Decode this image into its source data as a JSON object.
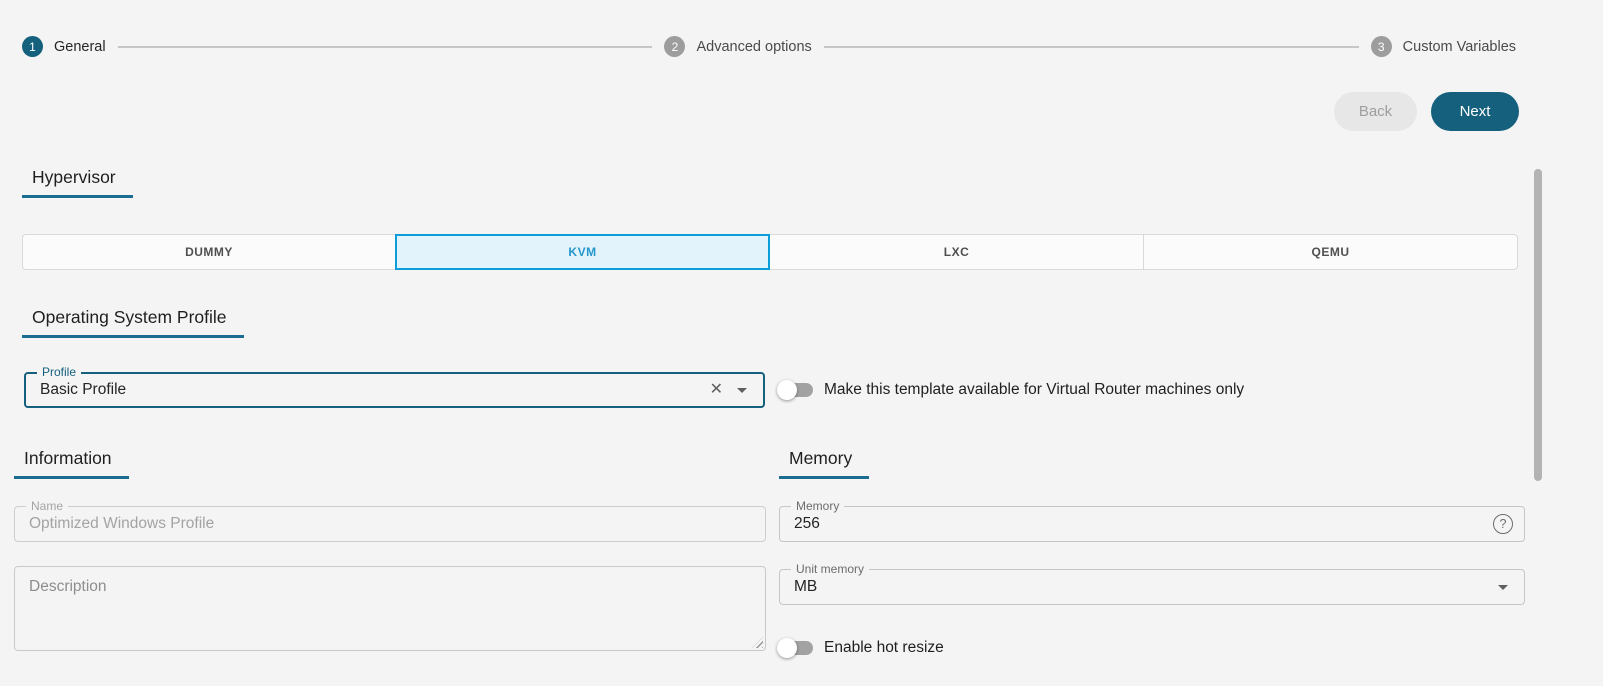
{
  "colors": {
    "page_bg": "#f4f4f4",
    "primary": "#15607d",
    "accent_underline": "#1a6c90",
    "step_inactive": "#9d9d9d",
    "kvm_border": "#0c9ed9",
    "kvm_bg": "#e3f3fb",
    "kvm_text": "#2497cb"
  },
  "stepper": {
    "steps": [
      {
        "number": "1",
        "label": "General",
        "active": true
      },
      {
        "number": "2",
        "label": "Advanced options",
        "active": false
      },
      {
        "number": "3",
        "label": "Custom Variables",
        "active": false
      }
    ]
  },
  "actions": {
    "back": "Back",
    "next": "Next"
  },
  "hypervisor": {
    "heading": "Hypervisor",
    "options": [
      {
        "label": "DUMMY",
        "selected": false
      },
      {
        "label": "KVM",
        "selected": true
      },
      {
        "label": "LXC",
        "selected": false
      },
      {
        "label": "QEMU",
        "selected": false
      }
    ]
  },
  "os_profile": {
    "heading": "Operating System Profile",
    "profile_field": {
      "label": "Profile",
      "value": "Basic Profile"
    },
    "vrouter_toggle": {
      "label": "Make this template available for Virtual Router machines only",
      "enabled": false
    }
  },
  "information": {
    "heading": "Information",
    "name_field": {
      "label": "Name",
      "value": "Optimized Windows Profile",
      "disabled": true
    },
    "description_field": {
      "placeholder": "Description",
      "value": ""
    }
  },
  "memory": {
    "heading": "Memory",
    "memory_field": {
      "label": "Memory",
      "value": "256"
    },
    "unit_field": {
      "label": "Unit memory",
      "value": "MB"
    },
    "hot_resize_toggle": {
      "label": "Enable hot resize",
      "enabled": false
    }
  }
}
